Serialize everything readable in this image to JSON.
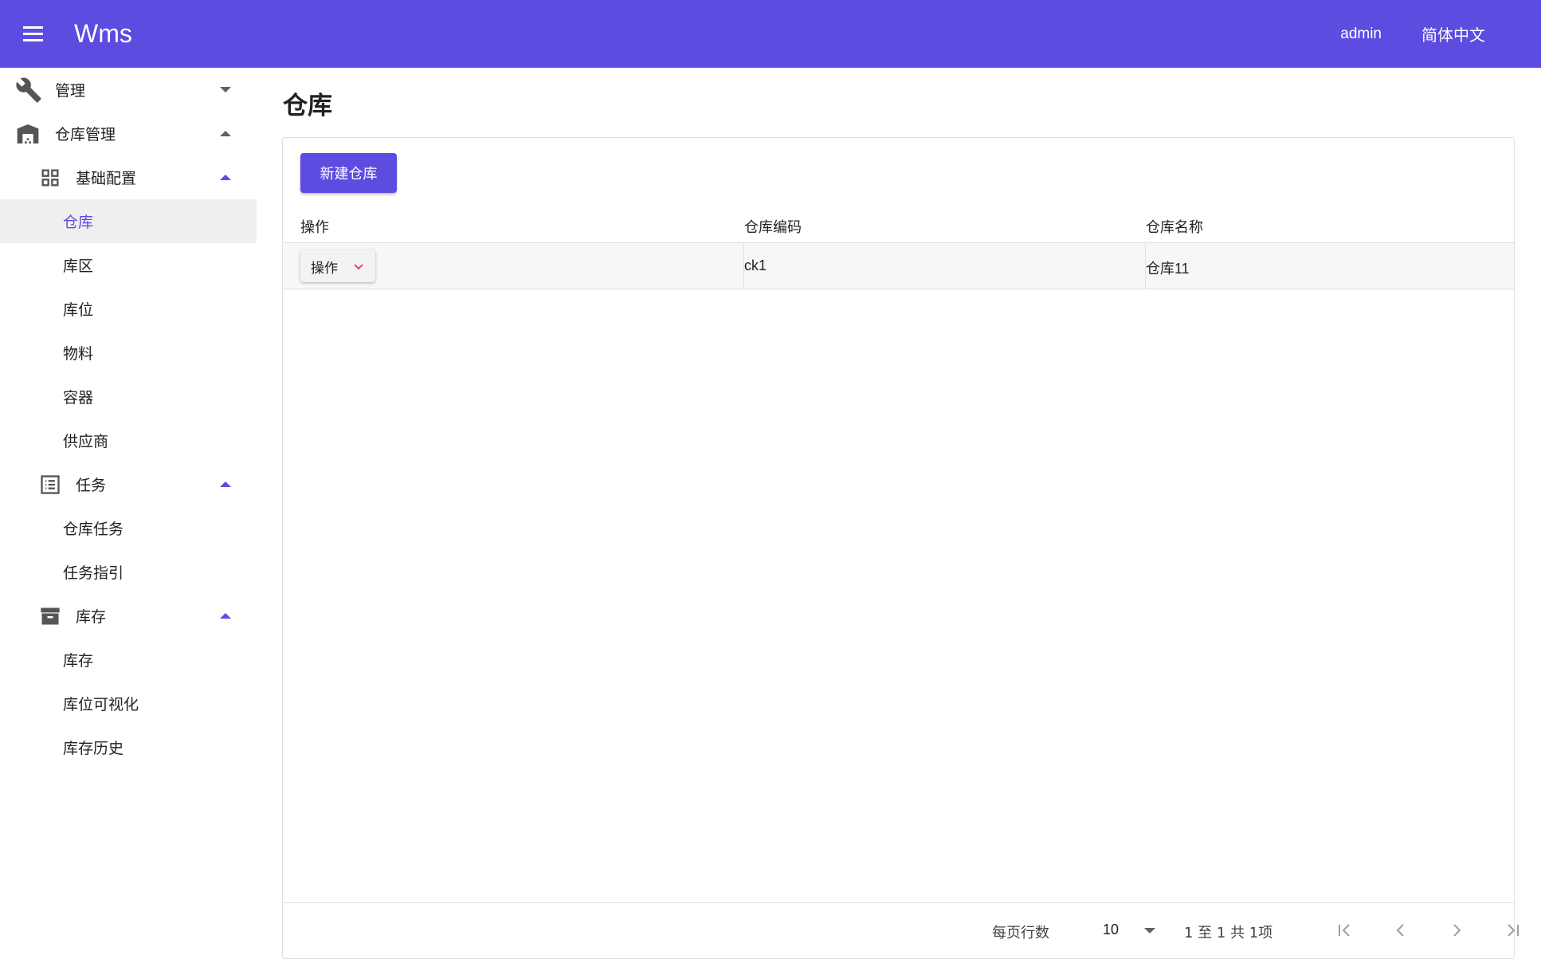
{
  "appbar": {
    "title": "Wms",
    "user": "admin",
    "language": "简体中文"
  },
  "sidebar": {
    "items": [
      {
        "label": "管理",
        "icon": "wrench-icon"
      },
      {
        "label": "仓库管理",
        "icon": "warehouse-icon"
      },
      {
        "label": "基础配置",
        "icon": "grid-icon"
      },
      {
        "label": "仓库"
      },
      {
        "label": "库区"
      },
      {
        "label": "库位"
      },
      {
        "label": "物料"
      },
      {
        "label": "容器"
      },
      {
        "label": "供应商"
      },
      {
        "label": "任务",
        "icon": "list-icon"
      },
      {
        "label": "仓库任务"
      },
      {
        "label": "任务指引"
      },
      {
        "label": "库存",
        "icon": "archive-icon"
      },
      {
        "label": "库存"
      },
      {
        "label": "库位可视化"
      },
      {
        "label": "库存历史"
      }
    ]
  },
  "page": {
    "title": "仓库",
    "new_button": "新建仓库"
  },
  "table": {
    "columns": [
      "操作",
      "仓库编码",
      "仓库名称"
    ],
    "rows": [
      {
        "action": "操作",
        "code": "ck1",
        "name": "仓库11"
      }
    ]
  },
  "pagination": {
    "rows_per_page_label": "每页行数",
    "rows_per_page": "10",
    "range": "1 至 1 共 1项"
  },
  "colors": {
    "primary": "#5c4ce0",
    "action_chevron": "#e53950"
  }
}
